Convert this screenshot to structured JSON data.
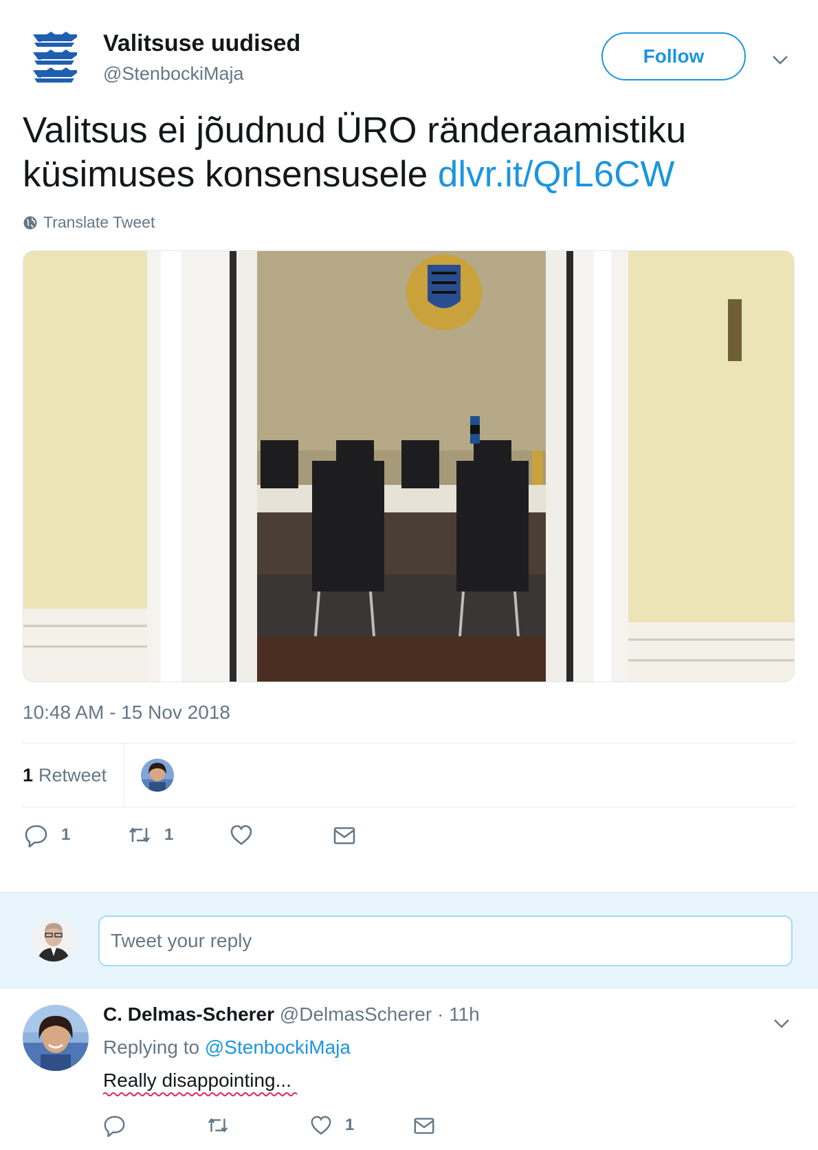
{
  "tweet": {
    "author_name": "Valitsuse uudised",
    "author_handle": "@StenbockiMaja",
    "follow_label": "Follow",
    "text": "Valitsus ei jõudnud ÜRO ränderaamistiku küsimuses konsensusele",
    "link": "dlvr.it/QrL6CW",
    "translate_label": "Translate Tweet",
    "timestamp": "10:48 AM - 15 Nov 2018",
    "retweet_count": "1",
    "retweet_label": "Retweet",
    "reply_count": "1",
    "retweet_action_count": "1",
    "like_count": ""
  },
  "reply_box": {
    "placeholder": "Tweet your reply"
  },
  "reply": {
    "author_name": "C. Delmas-Scherer",
    "author_handle": "@DelmasScherer",
    "separator": "·",
    "time": "11h",
    "replying_prefix": "Replying to",
    "replying_to": "@StenbockiMaja",
    "text": "Really disappointing...",
    "like_count": "1"
  },
  "colors": {
    "accent": "#1b95e0",
    "muted": "#657786",
    "reply_bar_bg": "#e8f5fd",
    "crest_blue": "#1f5fb0"
  },
  "icons": [
    "estonia-crest-icon",
    "chevron-down-icon",
    "globe-icon",
    "reply-icon",
    "retweet-icon",
    "heart-icon",
    "envelope-icon"
  ]
}
